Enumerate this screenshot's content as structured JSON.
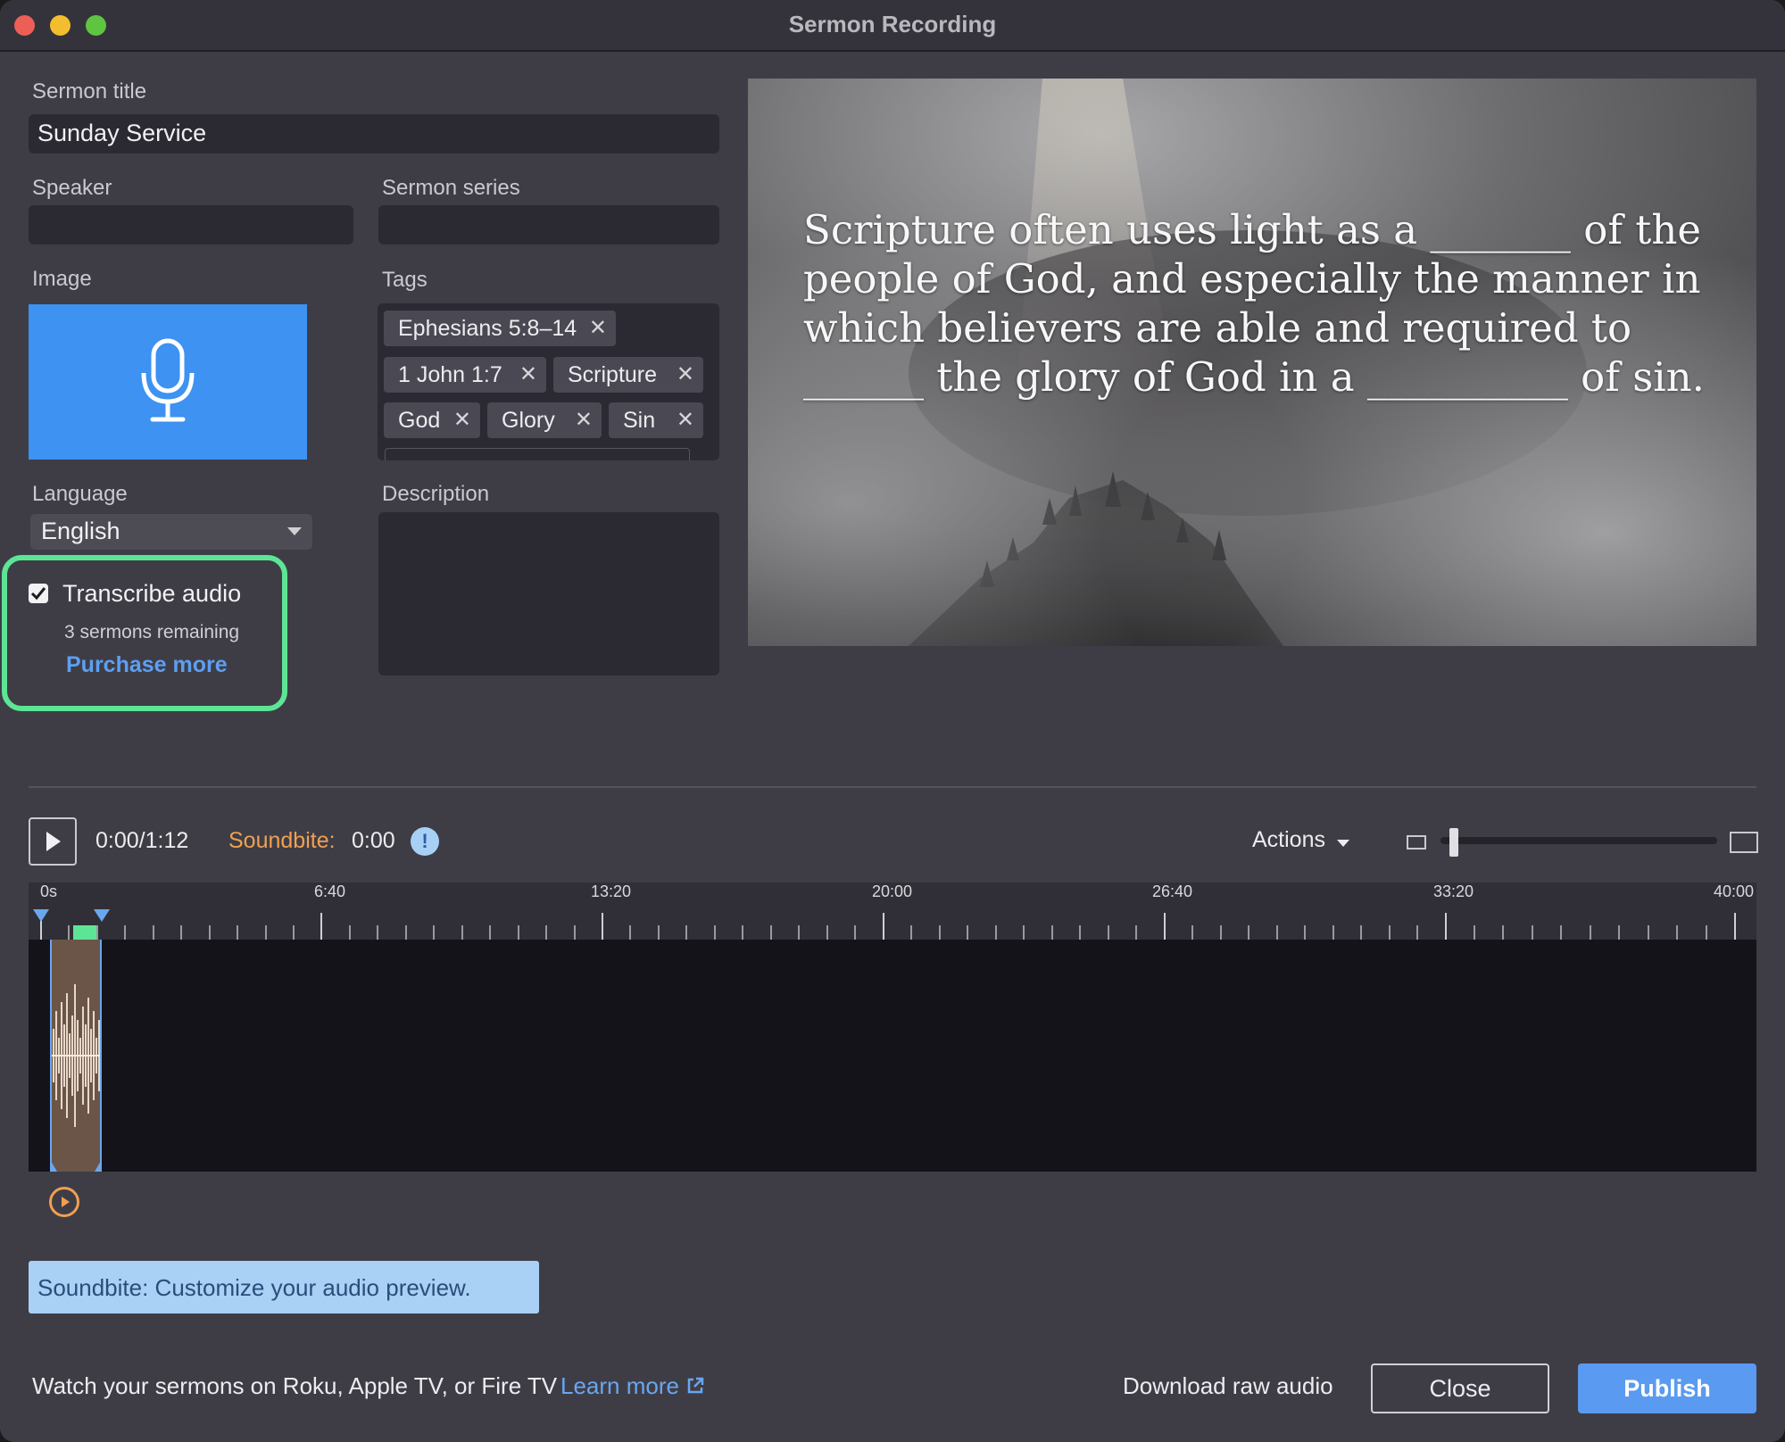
{
  "window": {
    "title": "Sermon Recording"
  },
  "form": {
    "title_label": "Sermon title",
    "title_value": "Sunday Service",
    "speaker_label": "Speaker",
    "speaker_value": "",
    "series_label": "Sermon series",
    "series_value": "",
    "image_label": "Image",
    "image_icon": "microphone-icon",
    "tags_label": "Tags",
    "tags": [
      {
        "label": "Ephesians 5:8–14"
      },
      {
        "label": "1 John 1:7"
      },
      {
        "label": "Scripture"
      },
      {
        "label": "God"
      },
      {
        "label": "Glory"
      },
      {
        "label": "Sin"
      }
    ],
    "language_label": "Language",
    "language_value": "English",
    "description_label": "Description",
    "transcribe_label": "Transcribe audio",
    "transcribe_checked": true,
    "remaining_text": "3 sermons remaining",
    "purchase_label": "Purchase more"
  },
  "preview": {
    "slide_text": "Scripture often uses light as a _______ of the people of God, and especially the manner in which believers are able and required to ______ the glory of God in a __________ of sin."
  },
  "player": {
    "time": "0:00/1:12",
    "soundbite_label": "Soundbite:",
    "soundbite_time": "0:00",
    "info_icon": "!",
    "actions_label": "Actions"
  },
  "timeline": {
    "ticks": [
      "0s",
      "6:40",
      "13:20",
      "20:00",
      "26:40",
      "33:20",
      "40:00"
    ]
  },
  "hint": {
    "text": "Soundbite: Customize your audio preview."
  },
  "footer": {
    "promo_text": "Watch your sermons on Roku, Apple TV, or Fire TV",
    "learn_more": "Learn more",
    "download_label": "Download raw audio",
    "close_label": "Close",
    "publish_label": "Publish"
  },
  "colors": {
    "accent_green": "#5de596",
    "accent_blue": "#5a9af0",
    "soundbite_orange": "#f0a050",
    "image_blue": "#3d92f2"
  }
}
